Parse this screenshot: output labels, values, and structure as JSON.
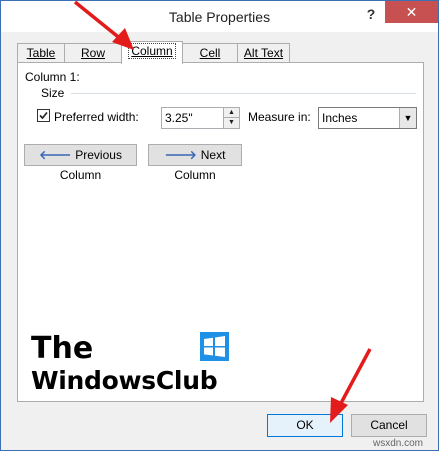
{
  "window": {
    "title": "Table Properties",
    "help_glyph": "?",
    "close_glyph": "✕"
  },
  "tabs": [
    {
      "label": "Table",
      "active": false
    },
    {
      "label": "Row",
      "active": false
    },
    {
      "label": "Column",
      "active": true
    },
    {
      "label": "Cell",
      "active": false
    },
    {
      "label": "Alt Text",
      "active": false
    }
  ],
  "column_panel": {
    "heading": "Column 1:",
    "size_label": "Size",
    "preferred_width_checked": true,
    "preferred_width_label": "Preferred width:",
    "preferred_width_value": "3.25\"",
    "measure_in_label": "Measure in:",
    "measure_in_value": "Inches",
    "previous_column_label": "Previous Column",
    "next_column_label": "Next Column"
  },
  "footer": {
    "ok_label": "OK",
    "cancel_label": "Cancel"
  },
  "watermark": {
    "line1": "The",
    "line2": "WindowsClub",
    "site": "wsxdn.com"
  },
  "colors": {
    "annotation_arrow": "#e31b1b",
    "close_button": "#c75050",
    "window_border": "#3d6fb4",
    "nav_icon": "#3a68b5",
    "logo_blue": "#1e90e6"
  },
  "icons": {
    "previous": "left-arrow-icon",
    "next": "right-arrow-icon",
    "spin_up": "up-triangle-icon",
    "spin_down": "down-triangle-icon",
    "dropdown": "chevron-down-icon"
  }
}
